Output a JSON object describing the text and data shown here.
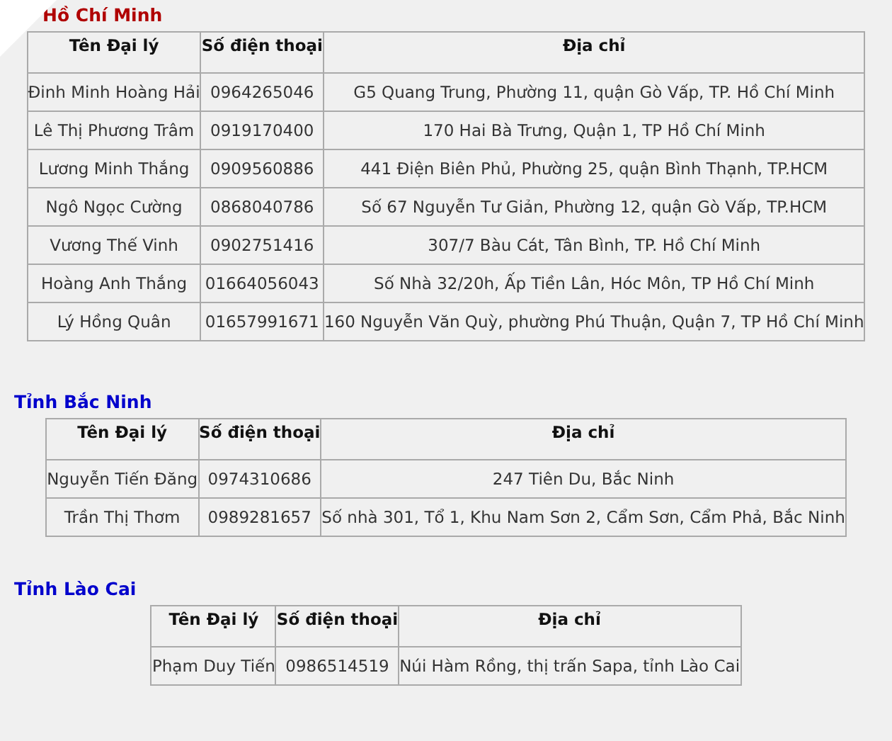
{
  "sections": [
    {
      "heading": "Hồ Chí Minh",
      "color": "#b00000",
      "columns": [
        "Tên Đại lý",
        "Số điện thoại",
        "Địa chỉ"
      ],
      "rows": [
        [
          "Đinh Minh Hoàng Hải",
          "0964265046",
          "G5 Quang Trung, Phường 11, quận Gò Vấp, TP. Hồ Chí Minh"
        ],
        [
          "Lê Thị Phương Trâm",
          "0919170400",
          "170 Hai Bà Trưng, Quận 1, TP Hồ Chí Minh"
        ],
        [
          "Lương Minh Thắng",
          "0909560886",
          "441 Điện Biên Phủ, Phường 25, quận Bình Thạnh, TP.HCM"
        ],
        [
          "Ngô Ngọc Cường",
          "0868040786",
          "Số 67 Nguyễn Tư Giản, Phường 12, quận Gò Vấp, TP.HCM"
        ],
        [
          "Vương Thế Vinh",
          "0902751416",
          "307/7 Bàu Cát, Tân Bình, TP. Hồ Chí Minh"
        ],
        [
          "Hoàng Anh Thắng",
          "01664056043",
          "Số Nhà 32/20h, Ấp Tiền Lân, Hóc Môn, TP Hồ Chí Minh"
        ],
        [
          "Lý Hồng Quân",
          "01657991671",
          "160 Nguyễn Văn Quỳ, phường Phú Thuận, Quận 7, TP Hồ Chí Minh"
        ]
      ]
    },
    {
      "heading": "Tỉnh Bắc Ninh",
      "color": "#0000cc",
      "columns": [
        "Tên Đại lý",
        "Số điện thoại",
        "Địa chỉ"
      ],
      "rows": [
        [
          "Nguyễn Tiến Đăng",
          "0974310686",
          "247 Tiên Du, Bắc Ninh"
        ],
        [
          "Trần Thị Thơm",
          "0989281657",
          "Số nhà 301, Tổ 1, Khu Nam Sơn 2, Cẩm Sơn, Cẩm Phả, Bắc Ninh"
        ]
      ]
    },
    {
      "heading": "Tỉnh Lào Cai",
      "color": "#0000cc",
      "columns": [
        "Tên Đại lý",
        "Số điện thoại",
        "Địa chỉ"
      ],
      "rows": [
        [
          "Phạm Duy Tiến",
          "0986514519",
          "Núi Hàm Rồng, thị trấn Sapa, tỉnh Lào Cai"
        ]
      ]
    }
  ]
}
